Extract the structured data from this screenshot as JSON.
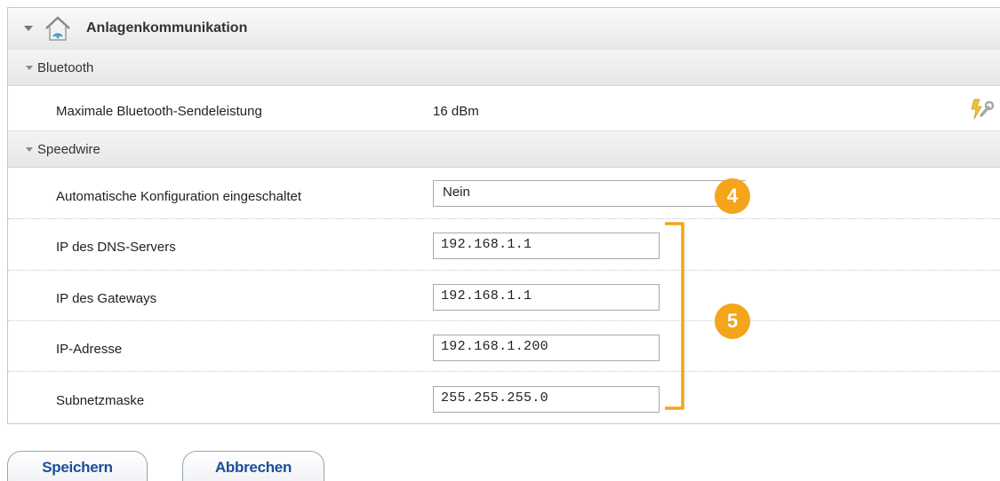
{
  "header": {
    "title": "Anlagenkommunikation",
    "icon": "house-signal-icon"
  },
  "bluetooth": {
    "section_label": "Bluetooth",
    "max_power_label": "Maximale Bluetooth-Sendeleistung",
    "max_power_value": "16  dBm"
  },
  "speedwire": {
    "section_label": "Speedwire",
    "auto_config_label": "Automatische Konfiguration eingeschaltet",
    "auto_config_value": "Nein",
    "fields": [
      {
        "label": "IP des DNS-Servers",
        "value": "192.168.1.1"
      },
      {
        "label": "IP des Gateways",
        "value": "192.168.1.1"
      },
      {
        "label": "IP-Adresse",
        "value": "192.168.1.200"
      },
      {
        "label": "Subnetzmaske",
        "value": "255.255.255.0"
      }
    ]
  },
  "callouts": {
    "four": "4",
    "five": "5"
  },
  "buttons": {
    "save": "Speichern",
    "cancel": "Abbrechen"
  },
  "colors": {
    "accent_orange": "#f4a51c",
    "button_text_blue": "#1a4e9a"
  }
}
